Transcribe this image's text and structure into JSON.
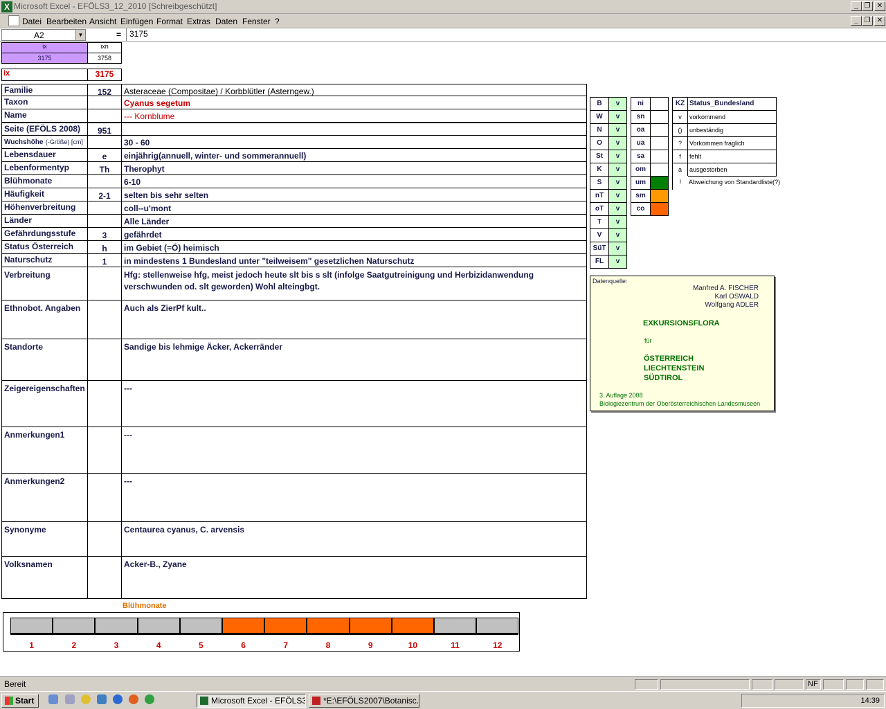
{
  "window": {
    "title": "Microsoft Excel - EFÖLS3_12_2010  [Schreibgeschützt]",
    "app_icon": "X"
  },
  "menu": [
    "Datei",
    "Bearbeiten",
    "Ansicht",
    "Einfügen",
    "Format",
    "Extras",
    "Daten",
    "Fenster",
    "?"
  ],
  "formula": {
    "cell_ref": "A2",
    "equals": "=",
    "value": "3175"
  },
  "header": {
    "ix_label": "ix",
    "ixn_label": "ixn",
    "ix_val": "3175",
    "ixn_val": "3758",
    "ix_row_label": "ix",
    "ix_row_val": "3175"
  },
  "rows": [
    {
      "label": "Familie",
      "code": "152",
      "value": "Asteraceae (Compositae)  /  Korbblütler (Asterngew.)"
    },
    {
      "label": "Taxon",
      "code": "",
      "value": "Cyanus segetum"
    },
    {
      "label": "Name",
      "code": "",
      "value": "--- Kornblume"
    },
    {
      "label": "Seite (EFÖLS 2008)",
      "code": "951",
      "value": ""
    },
    {
      "label": "Wuchshöhe",
      "label_small": "(-Größe) [cm]",
      "code": "",
      "value": "30 - 60"
    },
    {
      "label": "Lebensdauer",
      "code": "e",
      "value": "einjährig(annuell, winter- und sommerannuell)"
    },
    {
      "label": "Lebenformentyp",
      "code": "Th",
      "value": "Therophyt"
    },
    {
      "label": "Blühmonate",
      "code": "",
      "value": "6-10"
    },
    {
      "label": "Häufigkeit",
      "code": "2-1",
      "value": "selten bis sehr selten"
    },
    {
      "label": "Höhenverbreitung",
      "code": "",
      "value": "coll--u'mont"
    },
    {
      "label": "Länder",
      "code": "",
      "value": "Alle Länder"
    },
    {
      "label": "Gefährdungsstufe",
      "code": "3",
      "value": "gefährdet"
    },
    {
      "label": "Status Österreich",
      "code": "h",
      "value": "im Gebiet (=Ö) heimisch"
    },
    {
      "label": "Naturschutz",
      "code": "1",
      "value": "in mindestens 1 Bundesland unter \"teilweisem\" gesetzlichen Naturschutz"
    }
  ],
  "big_rows": [
    {
      "label": "Verbreitung",
      "value": "Hfg: stellenweise hfg, meist jedoch heute slt bis s slt (infolge Saatgutreinigung und Herbizidanwendung verschwunden od. slt geworden) Wohl alteingbgt."
    },
    {
      "label": "Ethnobot. Angaben",
      "value": "Auch als ZierPf kult.."
    },
    {
      "label": "Standorte",
      "value": "Sandige bis lehmige Äcker, Ackerränder"
    },
    {
      "label": "Zeigereigenschaften",
      "value": "---"
    },
    {
      "label": "Anmerkungen1",
      "value": "---"
    },
    {
      "label": "Anmerkungen2",
      "value": "---"
    },
    {
      "label": "Synonyme",
      "value": "Centaurea cyanus, C. arvensis"
    },
    {
      "label": "Volksnamen",
      "value": "Acker-B., Zyane"
    }
  ],
  "states": [
    {
      "code": "B",
      "status": "v"
    },
    {
      "code": "W",
      "status": "v"
    },
    {
      "code": "N",
      "status": "v"
    },
    {
      "code": "O",
      "status": "v"
    },
    {
      "code": "St",
      "status": "v"
    },
    {
      "code": "K",
      "status": "v"
    },
    {
      "code": "S",
      "status": "v"
    },
    {
      "code": "nT",
      "status": "v"
    },
    {
      "code": "oT",
      "status": "v"
    },
    {
      "code": "T",
      "status": "v"
    },
    {
      "code": "V",
      "status": "v"
    },
    {
      "code": "SüT",
      "status": "v"
    },
    {
      "code": "FL",
      "status": "v"
    }
  ],
  "altitude": [
    {
      "code": "ni",
      "color": "#ffffff"
    },
    {
      "code": "sn",
      "color": "#ffffff"
    },
    {
      "code": "oa",
      "color": "#ffffff"
    },
    {
      "code": "ua",
      "color": "#ffffff"
    },
    {
      "code": "sa",
      "color": "#ffffff"
    },
    {
      "code": "om",
      "color": "#ffffff"
    },
    {
      "code": "um",
      "color": "#008000"
    },
    {
      "code": "sm",
      "color": "#ff9900"
    },
    {
      "code": "co",
      "color": "#ff6600"
    }
  ],
  "legend": {
    "kz": "KZ",
    "title": "Status_Bundesland",
    "items": [
      {
        "code": "v",
        "text": "vorkommend"
      },
      {
        "code": "()",
        "text": "unbeständig"
      },
      {
        "code": "?",
        "text": "Vorkommen fraglich"
      },
      {
        "code": "f",
        "text": "fehlt"
      },
      {
        "code": "a",
        "text": "ausgestorben"
      },
      {
        "code": "!",
        "text": "Abweichung von Standardliste(?)"
      }
    ]
  },
  "source": {
    "heading": "Datenquelle:",
    "authors": [
      "Manfred A. FISCHER",
      "Karl OSWALD",
      "Wolfgang ADLER"
    ],
    "book": "EXKURSIONSFLORA",
    "fuer": "für",
    "countries": [
      "ÖSTERREICH",
      "LIECHTENSTEIN",
      "SÜDTIROL"
    ],
    "edition": "3. Auflage 2008",
    "publisher": "Biologiezentrum der Oberösterreichischen Landesmuseen"
  },
  "bloom": {
    "title": "Blühmonate",
    "months": [
      "1",
      "2",
      "3",
      "4",
      "5",
      "6",
      "7",
      "8",
      "9",
      "10",
      "11",
      "12"
    ],
    "active": [
      false,
      false,
      false,
      false,
      false,
      true,
      true,
      true,
      true,
      true,
      false,
      false
    ],
    "color_on": "#ff6600",
    "color_off": "#c0c0c0"
  },
  "status": {
    "ready": "Bereit",
    "nf": "NF"
  },
  "taskbar": {
    "start": "Start",
    "task1": "Microsoft Excel - EFÖLS3...",
    "task2": "*E:\\EFÖLS2007\\Botanisc...",
    "clock": "14:39"
  }
}
